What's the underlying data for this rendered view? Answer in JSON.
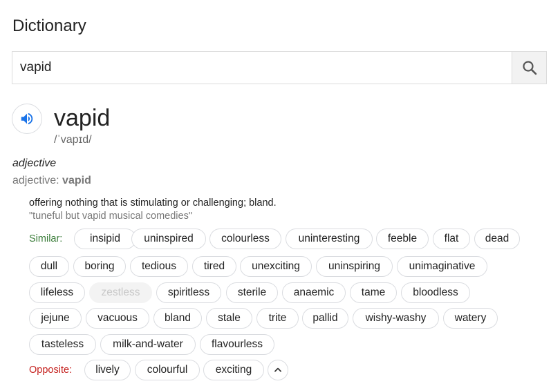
{
  "header": {
    "title": "Dictionary"
  },
  "search": {
    "value": "vapid",
    "icon": "search-icon"
  },
  "entry": {
    "word": "vapid",
    "phonetic": "/ˈvapɪd/",
    "speaker_icon": "volume-icon",
    "part_of_speech": "adjective",
    "form_prefix": "adjective: ",
    "form_word": "vapid",
    "definition": "offering nothing that is stimulating or challenging; bland.",
    "example": "\"tuneful but vapid musical comedies\""
  },
  "similar": {
    "label": "Similar:",
    "words": [
      "insipid",
      "uninspired",
      "colourless",
      "uninteresting",
      "feeble",
      "flat",
      "dead",
      "dull",
      "boring",
      "tedious",
      "tired",
      "unexciting",
      "uninspiring",
      "unimaginative",
      "lifeless",
      "zestless",
      "spiritless",
      "sterile",
      "anaemic",
      "tame",
      "bloodless",
      "jejune",
      "vacuous",
      "bland",
      "stale",
      "trite",
      "pallid",
      "wishy-washy",
      "watery",
      "tasteless",
      "milk-and-water",
      "flavourless"
    ]
  },
  "opposite": {
    "label": "Opposite:",
    "words": [
      "lively",
      "colourful",
      "exciting"
    ]
  },
  "colors": {
    "similar_label": "#3b7d3a",
    "opposite_label": "#c5221f",
    "speaker": "#1a73e8"
  }
}
